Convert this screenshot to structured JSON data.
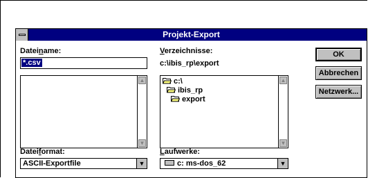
{
  "window": {
    "title": "Projekt-Export"
  },
  "filename": {
    "label_pre": "Datei",
    "label_u": "n",
    "label_post": "ame:",
    "value": "*.csv"
  },
  "directories": {
    "label_u": "V",
    "label_post": "erzeichnisse:",
    "current_path": "c:\\ibis_rp\\export",
    "tree": [
      "c:\\",
      "ibis_rp",
      "export"
    ]
  },
  "format": {
    "label_pre": "Datei",
    "label_u": "f",
    "label_post": "ormat:",
    "value": "ASCII-Exportfile"
  },
  "drives": {
    "label_u": "L",
    "label_post": "aufwerke:",
    "value": "c: ms-dos_62"
  },
  "buttons": {
    "ok": "OK",
    "cancel": "Abbrechen",
    "network": "Netzwerk..."
  }
}
